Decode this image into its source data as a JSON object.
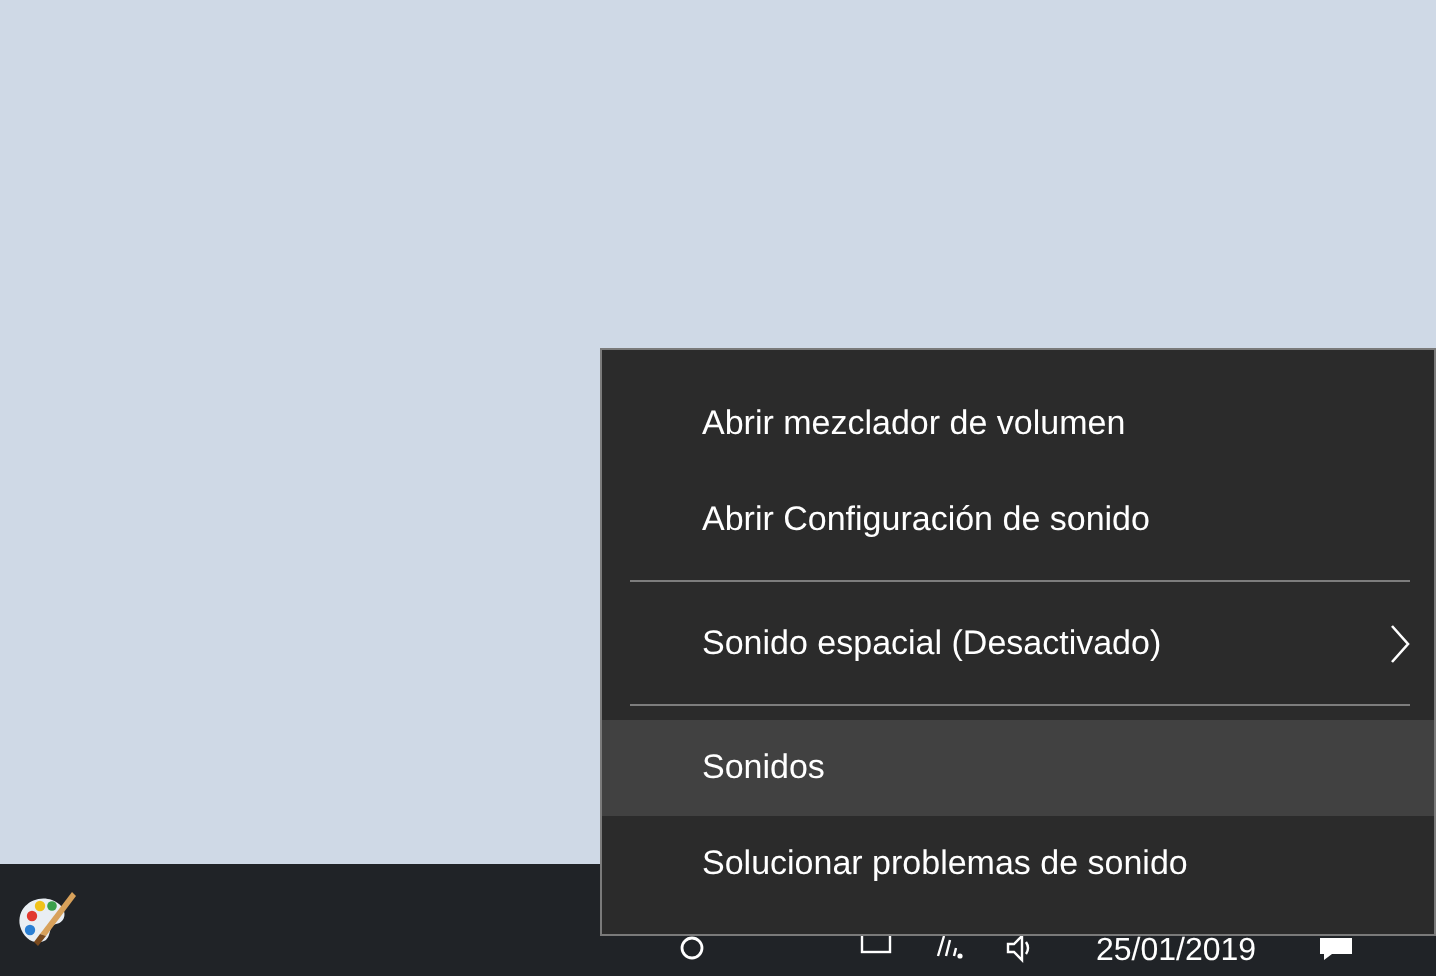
{
  "context_menu": {
    "items": [
      {
        "kind": "item",
        "label": "Abrir mezclador de volumen",
        "selected": false,
        "submenu": false
      },
      {
        "kind": "item",
        "label": "Abrir Configuración de sonido",
        "selected": false,
        "submenu": false
      },
      {
        "kind": "separator"
      },
      {
        "kind": "item",
        "label": "Sonido espacial (Desactivado)",
        "selected": false,
        "submenu": true
      },
      {
        "kind": "separator"
      },
      {
        "kind": "item",
        "label": "Sonidos",
        "selected": true,
        "submenu": false
      },
      {
        "kind": "item",
        "label": "Solucionar problemas de sonido",
        "selected": false,
        "submenu": false
      }
    ]
  },
  "taskbar": {
    "clock": {
      "date": "25/01/2019"
    }
  }
}
